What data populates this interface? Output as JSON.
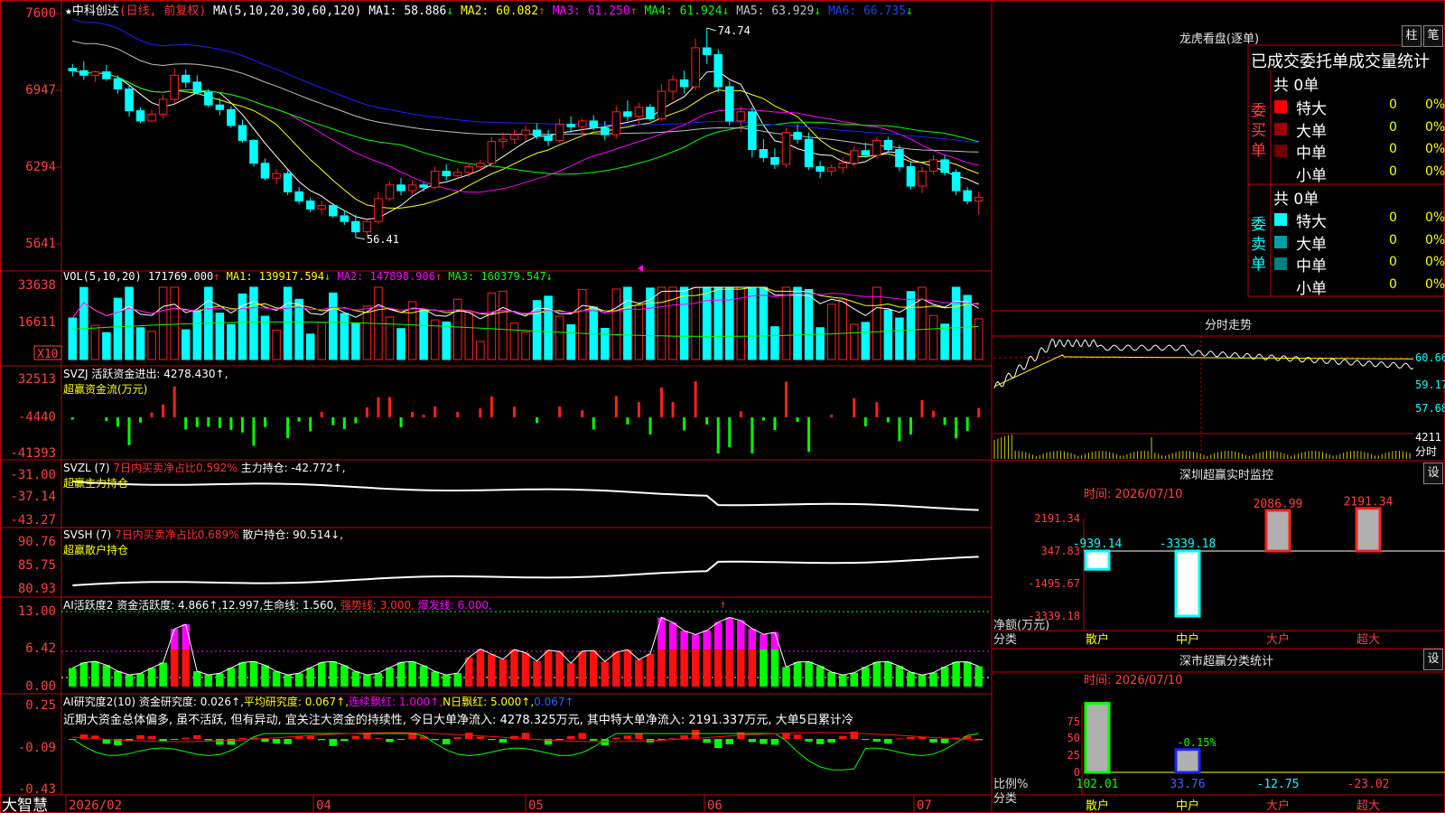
{
  "colors": {
    "up": "#ff2020",
    "down": "#00ffff",
    "ma_white": "#ffffff",
    "ma_yellow": "#ffff00",
    "ma_magenta": "#ff00ff",
    "ma_green": "#00ff00",
    "ma_gray": "#c0c0c0",
    "ma_blue": "#2020ff",
    "grid": "#cc0000",
    "axis_text": "#ff4040"
  },
  "header": {
    "star": "★",
    "stock_name": "中科创达",
    "period_note": "(日线, 前复权)",
    "ma_label": "MA(5,10,20,30,60,120)",
    "ma_items": [
      {
        "label": "MA1: 58.886",
        "arrow": "↓",
        "color": "#ffffff"
      },
      {
        "label": "MA2: 60.082",
        "arrow": "↑",
        "color": "#ffff00"
      },
      {
        "label": "MA3: 61.250",
        "arrow": "↑",
        "color": "#ff00ff"
      },
      {
        "label": "MA4: 61.924",
        "arrow": "↓",
        "color": "#00ff00"
      },
      {
        "label": "MA5: 63.929",
        "arrow": "↓",
        "color": "#c0c0c0"
      },
      {
        "label": "MA6: 66.735",
        "arrow": "↓",
        "color": "#2040ff"
      }
    ],
    "max_label": "74.74",
    "min_label": "56.41"
  },
  "price_axis": [
    "7600",
    "6947",
    "6294",
    "5641"
  ],
  "vol_panel": {
    "header": "VOL(5,10,20)",
    "items": [
      {
        "label": "171769.000",
        "arrow": "↑",
        "color": "#ffffff"
      },
      {
        "label": "MA1: 139917.594",
        "arrow": "↓",
        "color": "#ffff00"
      },
      {
        "label": "MA2: 147898.906",
        "arrow": "↑",
        "color": "#ff00ff"
      },
      {
        "label": "MA3: 160379.547",
        "arrow": "↓",
        "color": "#00ff00"
      }
    ],
    "axis": [
      "33638",
      "16611"
    ],
    "unit": "X10"
  },
  "svzj_panel": {
    "header": "SVZJ  活跃资金进出: 4278.430↑,",
    "sub": "超赢资金流(万元)",
    "axis": [
      "32513",
      "-4440",
      "-41393"
    ]
  },
  "svzl_panel": {
    "header_name": "SVZL (7) ",
    "header_red": "7日内买卖净占比0.592%",
    "header_white": " 主力持仓: -42.772↑,",
    "sub": "超赢主力持仓",
    "axis": [
      "-31.00",
      "-37.14",
      "-43.27"
    ]
  },
  "svsh_panel": {
    "header_name": "SVSH (7) ",
    "header_red": "7日内买卖净占比0.689%",
    "header_white": " 散户持仓: 90.514↓,",
    "sub": "超赢散户持仓",
    "axis": [
      "90.76",
      "85.75",
      "80.93"
    ]
  },
  "ai_act_panel": {
    "header_white": "AI活跃度2 资金活跃度: 4.866↑,12.997,生命线: 1.560, ",
    "header_red": "强势线: 3.000, ",
    "header_mag": "爆发线: 6.000,",
    "axis": [
      "13.00",
      "6.42",
      "0.00"
    ]
  },
  "ai_res_panel": {
    "header_white": "AI研究度2(10) 资金研究度: 0.026↑,",
    "header_yel": "平均研究度: 0.067↑,",
    "header_mag": "连续飘红: 1.000↑,",
    "header_yel2": "N日飘红: 5.000↑,",
    "header_blue": "0.067↑",
    "comment": "近期大资金总体偏多, 虽不活跃, 但有异动, 宜关注大资金的持续性, 今日大单净流入: 4278.325万元, 其中特大单净流入: 2191.337万元, 大单5日累计冷",
    "axis": [
      "0.25",
      "-0.09",
      "-0.43"
    ]
  },
  "date_axis": {
    "brand": "大智慧",
    "labels": [
      "2026/02",
      "04",
      "05",
      "06",
      "07"
    ]
  },
  "right_panel": {
    "lhb_title": "龙虎看盘(逐单)",
    "btn1": "柱",
    "btn2": "笔",
    "stats_title": "已成交委托单成交量统计",
    "buy_label": "委买单",
    "sell_label": "委卖单",
    "buy_total": "共 0单",
    "sell_total": "共 0单",
    "buy_rows": [
      {
        "name": "特大",
        "count": "0",
        "pct": "0%",
        "color": "#ff0000"
      },
      {
        "name": "大单",
        "count": "0",
        "pct": "0%",
        "color": "#a00000"
      },
      {
        "name": "中单",
        "count": "0",
        "pct": "0%",
        "color": "#700000"
      },
      {
        "name": "小单",
        "count": "0",
        "pct": "0%",
        "color": ""
      }
    ],
    "sell_rows": [
      {
        "name": "特大",
        "count": "0",
        "pct": "0%",
        "color": "#00ffff"
      },
      {
        "name": "大单",
        "count": "0",
        "pct": "0%",
        "color": "#00a0a0"
      },
      {
        "name": "中单",
        "count": "0",
        "pct": "0%",
        "color": "#008080"
      },
      {
        "name": "小单",
        "count": "0",
        "pct": "0%",
        "color": ""
      }
    ],
    "intraday_title": "分时走势",
    "intraday_axis": [
      "60.66",
      "59.17",
      "57.68"
    ],
    "intraday_vol": [
      "4211",
      "分时"
    ],
    "monitor_title": "深圳超赢实时监控",
    "monitor_date": "时间: 2026/07/10",
    "set_btn": "设",
    "monitor_axis": [
      "2191.34",
      "347.83",
      "-1495.67",
      "-3339.18"
    ],
    "monitor_unit": "净额(万元)",
    "monitor_cat_label": "分类",
    "categories": [
      "散户",
      "中户",
      "大户",
      "超大"
    ],
    "monitor_values": [
      -939.14,
      -3339.18,
      2086.99,
      2191.34
    ],
    "monitor_value_labels": [
      "-939.14",
      "-3339.18",
      "2086.99",
      "2191.34"
    ],
    "class_title": "深市超赢分类统计",
    "class_date": "时间: 2026/07/10",
    "class_axis": [
      "75",
      "50",
      "25",
      "0"
    ],
    "class_unit": "比例%",
    "class_cat_label": "分类",
    "class_values": [
      102.01,
      33.76,
      -12.75,
      -23.02
    ],
    "class_value_labels": [
      "102.01",
      "33.76",
      "-12.75",
      "-23.02"
    ],
    "class_note": "-0.15%"
  },
  "chart_data": {
    "type": "line",
    "title": "中科创达",
    "xlabel": "",
    "ylabel": "",
    "ylim": [
      56.41,
      76.0
    ],
    "dates_axis": [
      "2026/02",
      "04",
      "05",
      "06",
      "07"
    ],
    "ohlc": [
      [
        71.2,
        71.6,
        70.5,
        71.0
      ],
      [
        71.0,
        71.8,
        70.2,
        70.6
      ],
      [
        70.6,
        71.0,
        70.0,
        70.9
      ],
      [
        70.9,
        71.5,
        70.1,
        70.3
      ],
      [
        70.3,
        70.6,
        69.0,
        69.4
      ],
      [
        69.4,
        69.8,
        67.0,
        67.5
      ],
      [
        67.5,
        67.8,
        66.4,
        66.6
      ],
      [
        66.6,
        67.6,
        66.5,
        67.2
      ],
      [
        67.2,
        68.9,
        66.8,
        68.5
      ],
      [
        68.5,
        71.2,
        68.1,
        70.6
      ],
      [
        70.6,
        71.1,
        69.5,
        70.0
      ],
      [
        70.0,
        70.6,
        68.9,
        69.1
      ],
      [
        69.1,
        69.4,
        67.8,
        68.0
      ],
      [
        68.0,
        68.6,
        67.1,
        67.6
      ],
      [
        67.6,
        67.9,
        66.0,
        66.2
      ],
      [
        66.2,
        66.7,
        64.7,
        64.9
      ],
      [
        64.9,
        65.0,
        62.6,
        62.9
      ],
      [
        62.9,
        63.3,
        61.4,
        61.6
      ],
      [
        61.6,
        62.4,
        61.1,
        62.0
      ],
      [
        62.0,
        62.3,
        60.1,
        60.4
      ],
      [
        60.4,
        60.8,
        59.3,
        59.6
      ],
      [
        59.6,
        59.9,
        58.6,
        58.9
      ],
      [
        58.9,
        59.6,
        58.4,
        59.2
      ],
      [
        59.2,
        59.4,
        58.1,
        58.3
      ],
      [
        58.3,
        58.8,
        57.5,
        57.8
      ],
      [
        57.8,
        58.4,
        56.4,
        56.9
      ],
      [
        56.9,
        58.0,
        56.5,
        57.8
      ],
      [
        57.8,
        60.4,
        57.6,
        59.8
      ],
      [
        59.8,
        61.3,
        59.6,
        61.0
      ],
      [
        61.0,
        61.6,
        60.1,
        60.5
      ],
      [
        60.5,
        61.4,
        60.2,
        61.0
      ],
      [
        61.0,
        61.2,
        60.4,
        60.8
      ],
      [
        60.8,
        62.6,
        60.6,
        62.2
      ],
      [
        62.2,
        62.8,
        61.4,
        61.8
      ],
      [
        61.8,
        62.5,
        61.5,
        62.1
      ],
      [
        62.1,
        62.9,
        61.7,
        62.6
      ],
      [
        62.6,
        63.2,
        62.2,
        62.9
      ],
      [
        62.9,
        65.2,
        62.8,
        64.8
      ],
      [
        64.8,
        65.6,
        64.2,
        65.0
      ],
      [
        65.0,
        65.8,
        64.6,
        65.4
      ],
      [
        65.4,
        66.2,
        64.8,
        65.8
      ],
      [
        65.8,
        66.4,
        65.0,
        65.3
      ],
      [
        65.3,
        65.8,
        64.4,
        64.9
      ],
      [
        64.9,
        66.8,
        64.7,
        66.3
      ],
      [
        66.3,
        67.0,
        65.6,
        66.1
      ],
      [
        66.1,
        66.8,
        65.2,
        66.6
      ],
      [
        66.6,
        67.1,
        65.8,
        66.0
      ],
      [
        66.0,
        66.6,
        64.9,
        65.4
      ],
      [
        65.4,
        67.9,
        65.1,
        67.4
      ],
      [
        67.4,
        68.4,
        66.6,
        67.0
      ],
      [
        67.0,
        68.2,
        66.2,
        67.8
      ],
      [
        67.8,
        68.1,
        66.6,
        66.8
      ],
      [
        66.8,
        69.8,
        66.6,
        69.2
      ],
      [
        69.2,
        70.6,
        68.4,
        70.2
      ],
      [
        70.2,
        71.0,
        69.0,
        69.6
      ],
      [
        69.6,
        73.8,
        69.3,
        73.0
      ],
      [
        73.0,
        74.74,
        71.6,
        72.4
      ],
      [
        72.4,
        72.9,
        69.1,
        69.6
      ],
      [
        69.6,
        70.1,
        66.2,
        66.6
      ],
      [
        66.6,
        67.9,
        65.6,
        67.4
      ],
      [
        67.4,
        67.8,
        63.4,
        64.1
      ],
      [
        64.1,
        65.0,
        63.0,
        63.4
      ],
      [
        63.4,
        64.2,
        62.4,
        62.8
      ],
      [
        62.8,
        66.0,
        62.5,
        65.6
      ],
      [
        65.6,
        66.3,
        64.6,
        65.0
      ],
      [
        65.0,
        65.6,
        62.3,
        62.6
      ],
      [
        62.6,
        63.1,
        61.6,
        62.2
      ],
      [
        62.2,
        62.8,
        61.8,
        62.5
      ],
      [
        62.5,
        63.4,
        62.0,
        62.9
      ],
      [
        62.9,
        64.4,
        62.6,
        64.0
      ],
      [
        64.0,
        64.7,
        63.4,
        63.6
      ],
      [
        63.6,
        65.2,
        63.3,
        64.9
      ],
      [
        64.9,
        65.2,
        63.8,
        64.1
      ],
      [
        64.1,
        64.5,
        62.2,
        62.6
      ],
      [
        62.6,
        63.0,
        60.6,
        60.9
      ],
      [
        60.9,
        62.6,
        60.3,
        62.2
      ],
      [
        62.2,
        63.6,
        61.9,
        63.2
      ],
      [
        63.2,
        63.6,
        61.8,
        62.1
      ],
      [
        62.1,
        62.4,
        60.1,
        60.5
      ],
      [
        60.5,
        60.8,
        59.3,
        59.6
      ],
      [
        59.6,
        60.4,
        58.4,
        59.9
      ]
    ]
  }
}
